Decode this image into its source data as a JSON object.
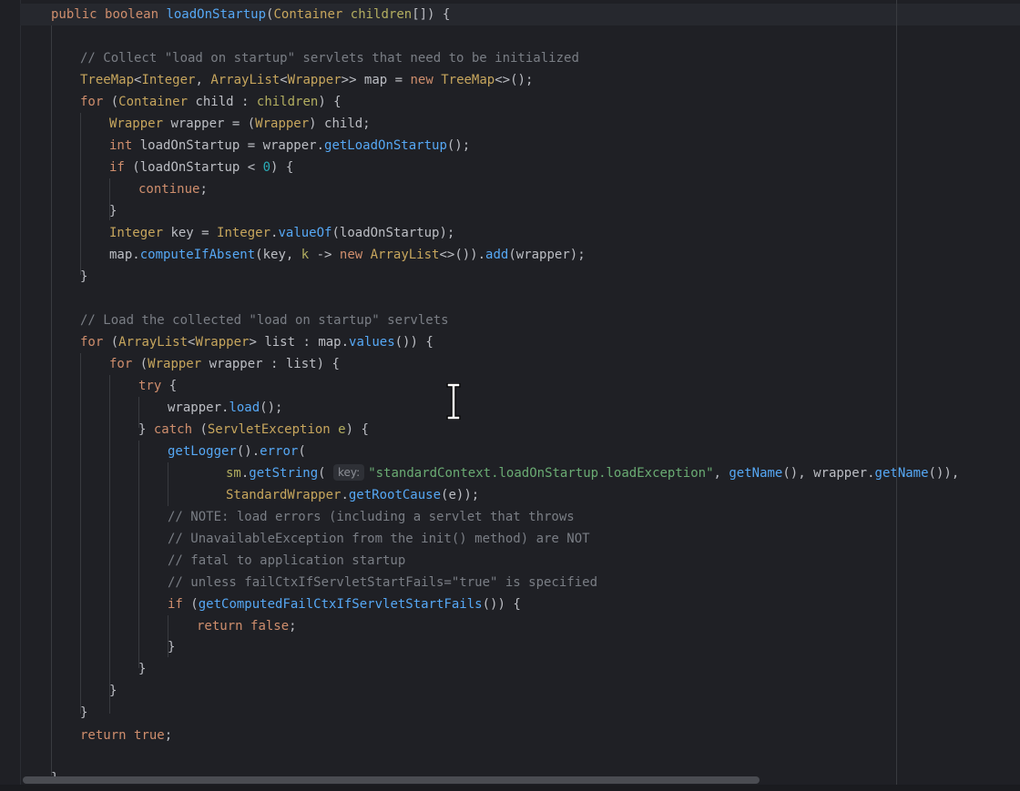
{
  "editor": {
    "language": "java",
    "lines": [
      [
        {
          "text": "public ",
          "cls": "k"
        },
        {
          "text": "boolean ",
          "cls": "k"
        },
        {
          "text": "loadOnStartup",
          "cls": "m"
        },
        {
          "text": "(",
          "cls": "p"
        },
        {
          "text": "Container ",
          "cls": "t"
        },
        {
          "text": "children",
          "cls": "pp"
        },
        {
          "text": "[]) {",
          "cls": "p"
        }
      ],
      [],
      [
        {
          "text": "// Collect \"load on startup\" servlets that need to be initialized",
          "cls": "c"
        }
      ],
      [
        {
          "text": "TreeMap",
          "cls": "t"
        },
        {
          "text": "<",
          "cls": "p"
        },
        {
          "text": "Integer",
          "cls": "t"
        },
        {
          "text": ", ",
          "cls": "p"
        },
        {
          "text": "ArrayList",
          "cls": "t"
        },
        {
          "text": "<",
          "cls": "p"
        },
        {
          "text": "Wrapper",
          "cls": "t"
        },
        {
          "text": ">> map = ",
          "cls": "p"
        },
        {
          "text": "new ",
          "cls": "k"
        },
        {
          "text": "TreeMap",
          "cls": "t"
        },
        {
          "text": "<>();",
          "cls": "p"
        }
      ],
      [
        {
          "text": "for ",
          "cls": "k"
        },
        {
          "text": "(",
          "cls": "p"
        },
        {
          "text": "Container ",
          "cls": "t"
        },
        {
          "text": "child : ",
          "cls": "v"
        },
        {
          "text": "children",
          "cls": "pp"
        },
        {
          "text": ") {",
          "cls": "p"
        }
      ],
      [
        {
          "text": "Wrapper ",
          "cls": "t"
        },
        {
          "text": "wrapper = (",
          "cls": "v"
        },
        {
          "text": "Wrapper",
          "cls": "t"
        },
        {
          "text": ") child;",
          "cls": "p"
        }
      ],
      [
        {
          "text": "int ",
          "cls": "k"
        },
        {
          "text": "loadOnStartup = wrapper.",
          "cls": "v"
        },
        {
          "text": "getLoadOnStartup",
          "cls": "m2"
        },
        {
          "text": "();",
          "cls": "p"
        }
      ],
      [
        {
          "text": "if ",
          "cls": "k"
        },
        {
          "text": "(loadOnStartup < ",
          "cls": "p"
        },
        {
          "text": "0",
          "cls": "n"
        },
        {
          "text": ") {",
          "cls": "p"
        }
      ],
      [
        {
          "text": "continue",
          "cls": "k"
        },
        {
          "text": ";",
          "cls": "p"
        }
      ],
      [
        {
          "text": "}",
          "cls": "p"
        }
      ],
      [
        {
          "text": "Integer ",
          "cls": "t"
        },
        {
          "text": "key = ",
          "cls": "v"
        },
        {
          "text": "Integer",
          "cls": "t"
        },
        {
          "text": ".",
          "cls": "p"
        },
        {
          "text": "valueOf",
          "cls": "m2"
        },
        {
          "text": "(loadOnStartup);",
          "cls": "p"
        }
      ],
      [
        {
          "text": "map.",
          "cls": "v"
        },
        {
          "text": "computeIfAbsent",
          "cls": "m2"
        },
        {
          "text": "(key, ",
          "cls": "p"
        },
        {
          "text": "k ",
          "cls": "pp"
        },
        {
          "text": "-> ",
          "cls": "p"
        },
        {
          "text": "new ",
          "cls": "k"
        },
        {
          "text": "ArrayList",
          "cls": "t"
        },
        {
          "text": "<>()).",
          "cls": "p"
        },
        {
          "text": "add",
          "cls": "m2"
        },
        {
          "text": "(wrapper);",
          "cls": "p"
        }
      ],
      [
        {
          "text": "}",
          "cls": "p"
        }
      ],
      [],
      [
        {
          "text": "// Load the collected \"load on startup\" servlets",
          "cls": "c"
        }
      ],
      [
        {
          "text": "for ",
          "cls": "k"
        },
        {
          "text": "(",
          "cls": "p"
        },
        {
          "text": "ArrayList",
          "cls": "t"
        },
        {
          "text": "<",
          "cls": "p"
        },
        {
          "text": "Wrapper",
          "cls": "t"
        },
        {
          "text": "> list : map.",
          "cls": "v"
        },
        {
          "text": "values",
          "cls": "m2"
        },
        {
          "text": "()) {",
          "cls": "p"
        }
      ],
      [
        {
          "text": "for ",
          "cls": "k"
        },
        {
          "text": "(",
          "cls": "p"
        },
        {
          "text": "Wrapper ",
          "cls": "t"
        },
        {
          "text": "wrapper : list) {",
          "cls": "v"
        }
      ],
      [
        {
          "text": "try ",
          "cls": "k"
        },
        {
          "text": "{",
          "cls": "p"
        }
      ],
      [
        {
          "text": "wrapper.",
          "cls": "v"
        },
        {
          "text": "load",
          "cls": "m2"
        },
        {
          "text": "();",
          "cls": "p"
        }
      ],
      [
        {
          "text": "} ",
          "cls": "p"
        },
        {
          "text": "catch ",
          "cls": "k"
        },
        {
          "text": "(",
          "cls": "p"
        },
        {
          "text": "ServletException ",
          "cls": "t"
        },
        {
          "text": "e",
          "cls": "pp"
        },
        {
          "text": ") {",
          "cls": "p"
        }
      ],
      [
        {
          "text": "getLogger",
          "cls": "m2"
        },
        {
          "text": "().",
          "cls": "p"
        },
        {
          "text": "error",
          "cls": "m2"
        },
        {
          "text": "(",
          "cls": "p"
        }
      ],
      [
        {
          "text": "sm",
          "cls": "pp"
        },
        {
          "text": ".",
          "cls": "p"
        },
        {
          "text": "getString",
          "cls": "m2"
        },
        {
          "text": "( ",
          "cls": "p"
        },
        {
          "text": "key:",
          "hint": true
        },
        {
          "text": "\"standardContext.loadOnStartup.loadException\"",
          "cls": "s"
        },
        {
          "text": ", ",
          "cls": "p"
        },
        {
          "text": "getName",
          "cls": "m2"
        },
        {
          "text": "(), wrapper.",
          "cls": "p"
        },
        {
          "text": "getName",
          "cls": "m2"
        },
        {
          "text": "()),",
          "cls": "p"
        }
      ],
      [
        {
          "text": "StandardWrapper",
          "cls": "t"
        },
        {
          "text": ".",
          "cls": "p"
        },
        {
          "text": "getRootCause",
          "cls": "m2"
        },
        {
          "text": "(e));",
          "cls": "p"
        }
      ],
      [
        {
          "text": "// NOTE: load errors (including a servlet that throws",
          "cls": "c"
        }
      ],
      [
        {
          "text": "// UnavailableException from the init() method) are NOT",
          "cls": "c"
        }
      ],
      [
        {
          "text": "// fatal to application startup",
          "cls": "c"
        }
      ],
      [
        {
          "text": "// unless failCtxIfServletStartFails=\"true\" is specified",
          "cls": "c"
        }
      ],
      [
        {
          "text": "if ",
          "cls": "k"
        },
        {
          "text": "(",
          "cls": "p"
        },
        {
          "text": "getComputedFailCtxIfServletStartFails",
          "cls": "m2"
        },
        {
          "text": "()) {",
          "cls": "p"
        }
      ],
      [
        {
          "text": "return ",
          "cls": "k"
        },
        {
          "text": "false",
          "cls": "k"
        },
        {
          "text": ";",
          "cls": "p"
        }
      ],
      [
        {
          "text": "}",
          "cls": "p"
        }
      ],
      [
        {
          "text": "}",
          "cls": "p"
        }
      ],
      [
        {
          "text": "}",
          "cls": "p"
        }
      ],
      [
        {
          "text": "}",
          "cls": "p"
        }
      ],
      [
        {
          "text": "return ",
          "cls": "k"
        },
        {
          "text": "true",
          "cls": "k"
        },
        {
          "text": ";",
          "cls": "p"
        }
      ],
      [],
      [
        {
          "text": "}",
          "cls": "p"
        }
      ]
    ]
  }
}
